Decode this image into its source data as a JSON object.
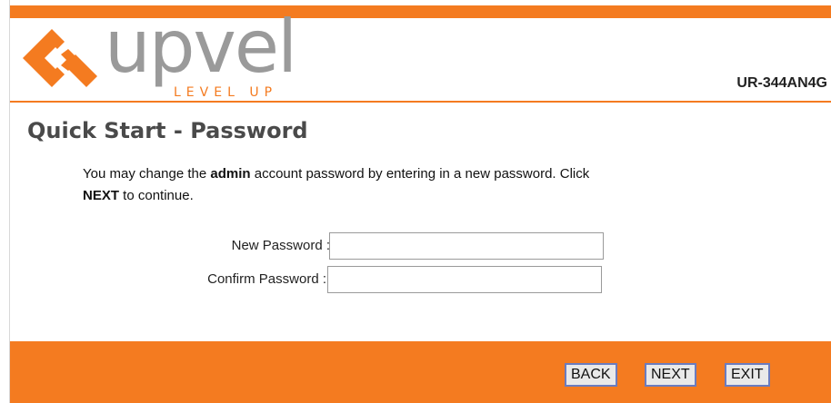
{
  "brand": {
    "name": "upvel",
    "tagline": "LEVEL UP",
    "model": "UR-344AN4G",
    "colors": {
      "accent": "#f47b20",
      "logo_gray": "#9a9a9a"
    }
  },
  "page": {
    "title": "Quick Start - Password"
  },
  "intro": {
    "part1": "You may change the ",
    "bold1": "admin",
    "part2": " account password by entering in a new password. Click ",
    "bold2": "NEXT",
    "part3": " to continue."
  },
  "form": {
    "new_password_label": "New Password :",
    "new_password_value": "",
    "confirm_password_label": "Confirm Password :",
    "confirm_password_value": ""
  },
  "buttons": {
    "back": "BACK",
    "next": "NEXT",
    "exit": "EXIT"
  }
}
